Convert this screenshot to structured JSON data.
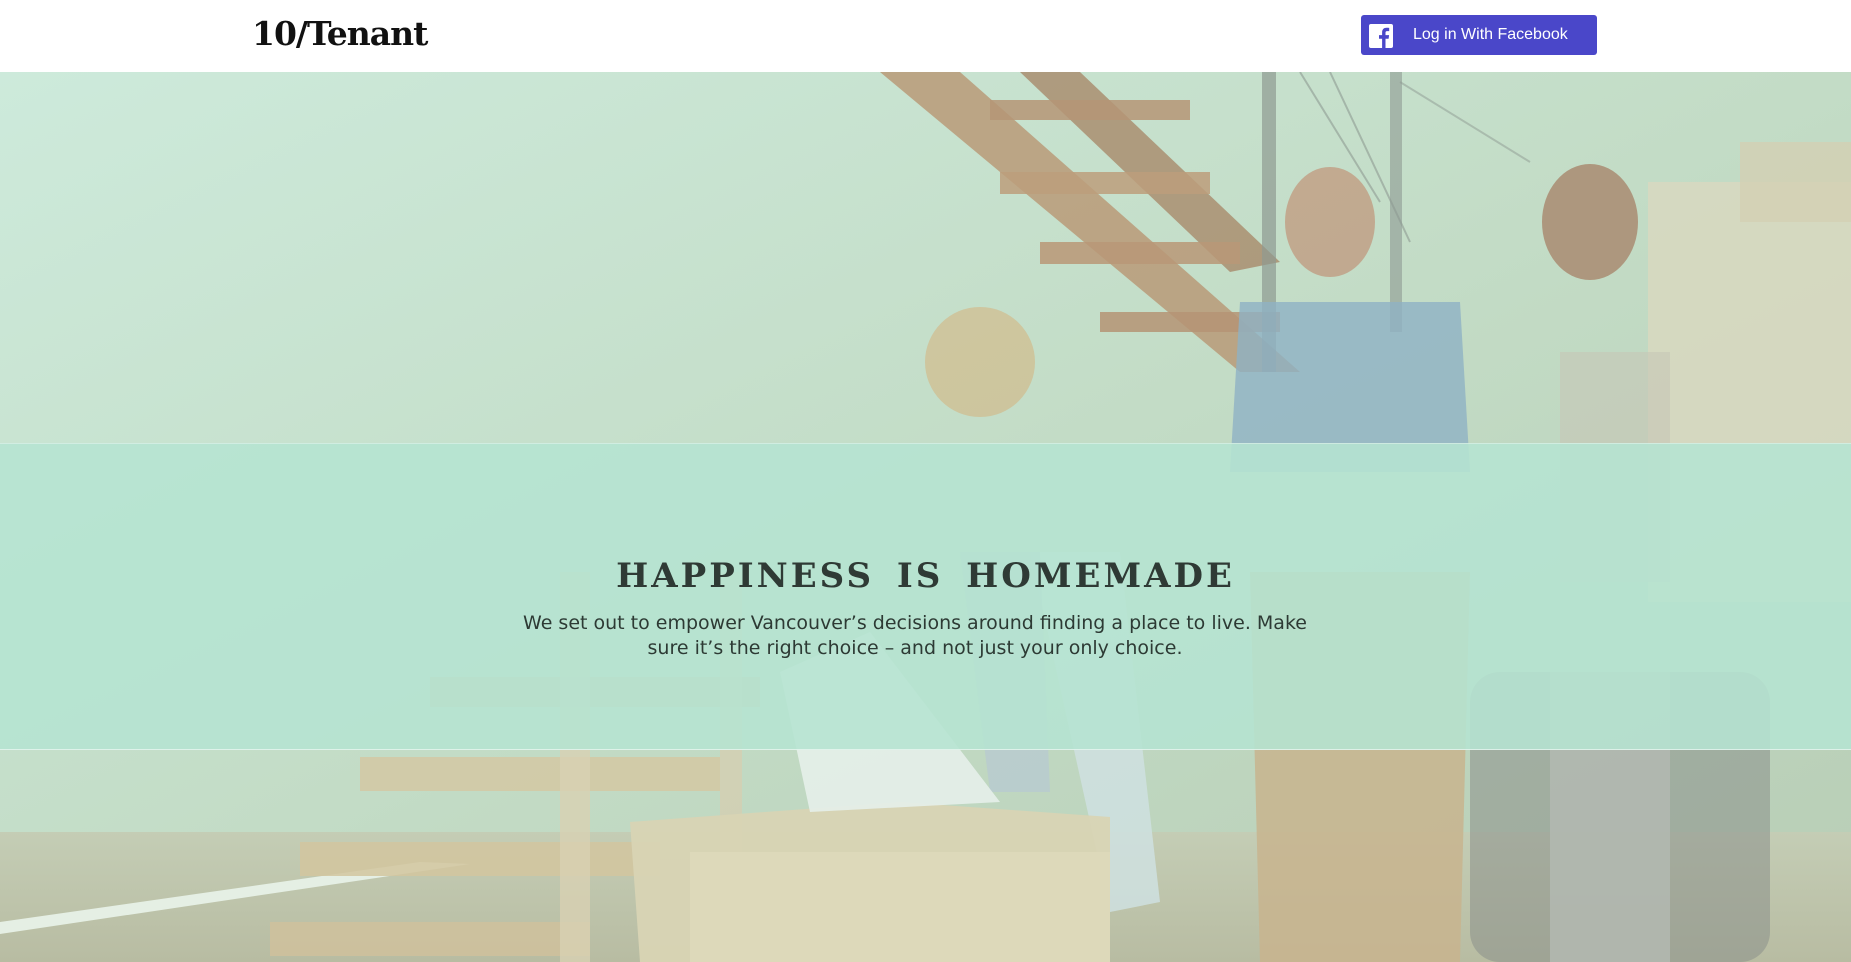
{
  "header": {
    "logo": "10/Tenant",
    "login_button_label": "Log in With Facebook",
    "login_button_color": "#4a47c9"
  },
  "hero": {
    "headline": "HAPPINESS IS HOMEMADE",
    "subtext": "We set out to empower Vancouver’s decisions around finding a place to live. Make sure it’s the right choice – and not just your only choice.",
    "overlay_color": "#b5e4d1"
  }
}
